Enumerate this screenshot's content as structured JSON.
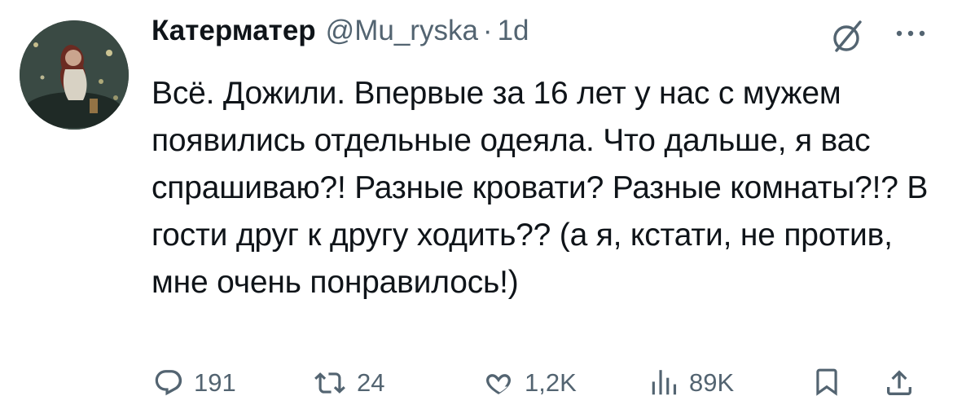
{
  "tweet": {
    "display_name": "Катерматер",
    "handle": "@Mu_ryska",
    "separator": "·",
    "time": "1d",
    "text": "Всё. Дожили. Впервые за 16 лет у нас с мужем появились отдельные одеяла. Что дальше, я вас спрашиваю?! Разные кровати? Разные комнаты?!? В гости друг к другу ходить?? (а я, кстати, не против, мне очень понравилось!)"
  },
  "actions": {
    "reply_count": "191",
    "retweet_count": "24",
    "like_count": "1,2K",
    "views_count": "89K"
  },
  "icons": {
    "avatar": "avatar-photo",
    "grok": "grok-icon",
    "more": "more-dots-icon",
    "reply": "reply-bubble-icon",
    "retweet": "retweet-arrows-icon",
    "like": "heart-icon",
    "views": "views-bars-icon",
    "bookmark": "bookmark-icon",
    "share": "share-icon"
  },
  "colors": {
    "text": "#0f1419",
    "secondary": "#536471",
    "background": "#ffffff"
  }
}
